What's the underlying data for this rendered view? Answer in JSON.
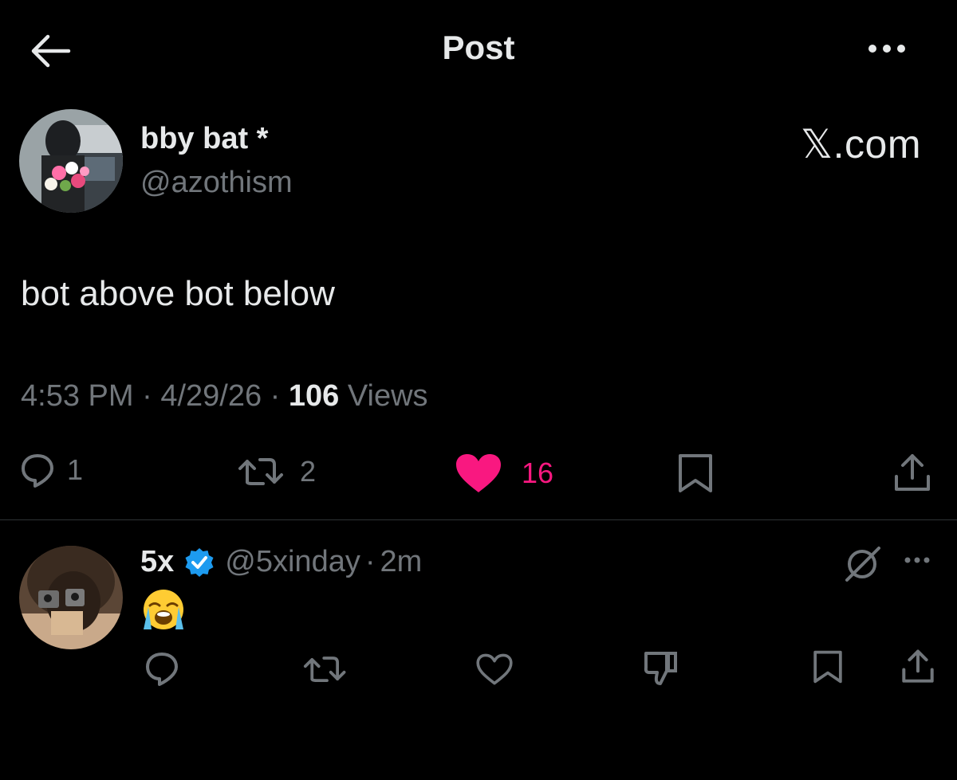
{
  "header": {
    "title": "Post",
    "back_icon": "arrow-left-icon",
    "more_icon": "more-horizontal-icon"
  },
  "post": {
    "author_name": "bby bat *",
    "author_handle": "@azothism",
    "watermark": "𝕏.com",
    "text": "bot above bot below",
    "time": "4:53 PM",
    "date": "4/29/26",
    "views_count": "106",
    "views_label": "Views",
    "separator": "·",
    "actions": {
      "replies": "1",
      "reposts": "2",
      "likes": "16"
    }
  },
  "reply": {
    "name": "5x",
    "handle": "@5xinday",
    "time": "2m",
    "separator": "·",
    "emoji": "loudly-crying-face-emoji"
  },
  "colors": {
    "background": "#000000",
    "text_primary": "#e7e9ea",
    "text_secondary": "#71767b",
    "like_pink": "#f91880",
    "verified_blue": "#1d9bf0",
    "divider": "#2f3336"
  }
}
